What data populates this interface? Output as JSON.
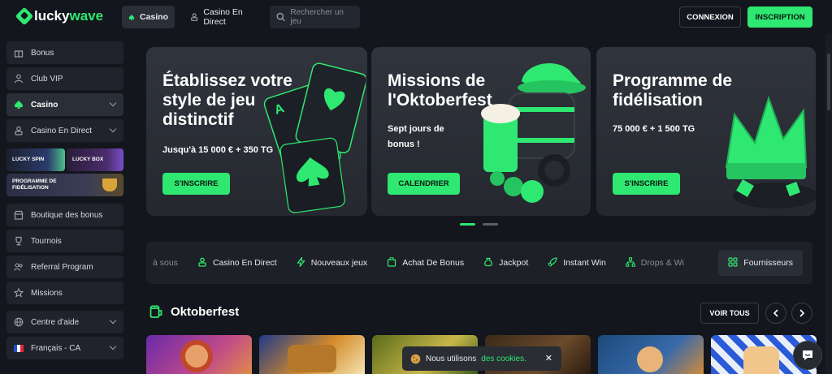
{
  "brand": {
    "part1": "lucky",
    "part2": "wave",
    "accent": "#2ee871"
  },
  "header": {
    "nav": [
      {
        "label": "Casino",
        "icon": "spade-icon"
      },
      {
        "label": "Casino En Direct",
        "icon": "dealer-icon"
      }
    ],
    "search": {
      "placeholder": "Rechercher un jeu"
    },
    "login_label": "CONNEXION",
    "register_label": "INSCRIPTION"
  },
  "sidebar": {
    "items": [
      {
        "label": "Bonus",
        "icon": "gift-icon"
      },
      {
        "label": "Club VIP",
        "icon": "user-icon"
      },
      {
        "label": "Casino",
        "icon": "spade-icon"
      },
      {
        "label": "Casino En Direct",
        "icon": "dealer-icon"
      },
      {
        "label": "Boutique des bonus",
        "icon": "shop-icon"
      },
      {
        "label": "Tournois",
        "icon": "trophy-icon"
      },
      {
        "label": "Referral Program",
        "icon": "users-icon"
      },
      {
        "label": "Missions",
        "icon": "star-icon"
      },
      {
        "label": "Centre d'aide",
        "icon": "globe-icon"
      },
      {
        "label": "Français - CA",
        "icon": "flag-fr-icon"
      }
    ],
    "promos": {
      "lucky_spin": "LUCKY SPIN",
      "lucky_box": "LUCKY BOX",
      "fidelity": "PROGRAMME DE FIDÉLISATION"
    }
  },
  "banners": [
    {
      "title": "Établissez votre style de jeu distinctif",
      "subtitle": "Jusqu'à 15 000 € + 350 TG",
      "cta": "S'INSCRIRE"
    },
    {
      "title": "Missions de l'Oktoberfest",
      "subtitle": "Sept jours de bonus !",
      "cta": "CALENDRIER"
    },
    {
      "title": "Programme de fidélisation",
      "subtitle": "75 000 € + 1 500 TG",
      "cta": "S'INSCRIRE"
    }
  ],
  "slider_dots": {
    "count": 2,
    "active": 1
  },
  "categories": [
    {
      "label": "à sous",
      "icon": ""
    },
    {
      "label": "Casino En Direct",
      "icon": "dealer-icon"
    },
    {
      "label": "Nouveaux jeux",
      "icon": "bolt-icon"
    },
    {
      "label": "Achat De Bonus",
      "icon": "cart-icon"
    },
    {
      "label": "Jackpot",
      "icon": "moneybag-icon"
    },
    {
      "label": "Instant Win",
      "icon": "rocket-icon"
    },
    {
      "label": "Drops & Wi",
      "icon": "network-icon"
    },
    {
      "label": "Fournisseurs",
      "icon": "grid-icon"
    }
  ],
  "section": {
    "title": "Oktoberfest",
    "view_all": "VOIR TOUS"
  },
  "cookie": {
    "text": "Nous utilisons",
    "link": "des cookies."
  }
}
